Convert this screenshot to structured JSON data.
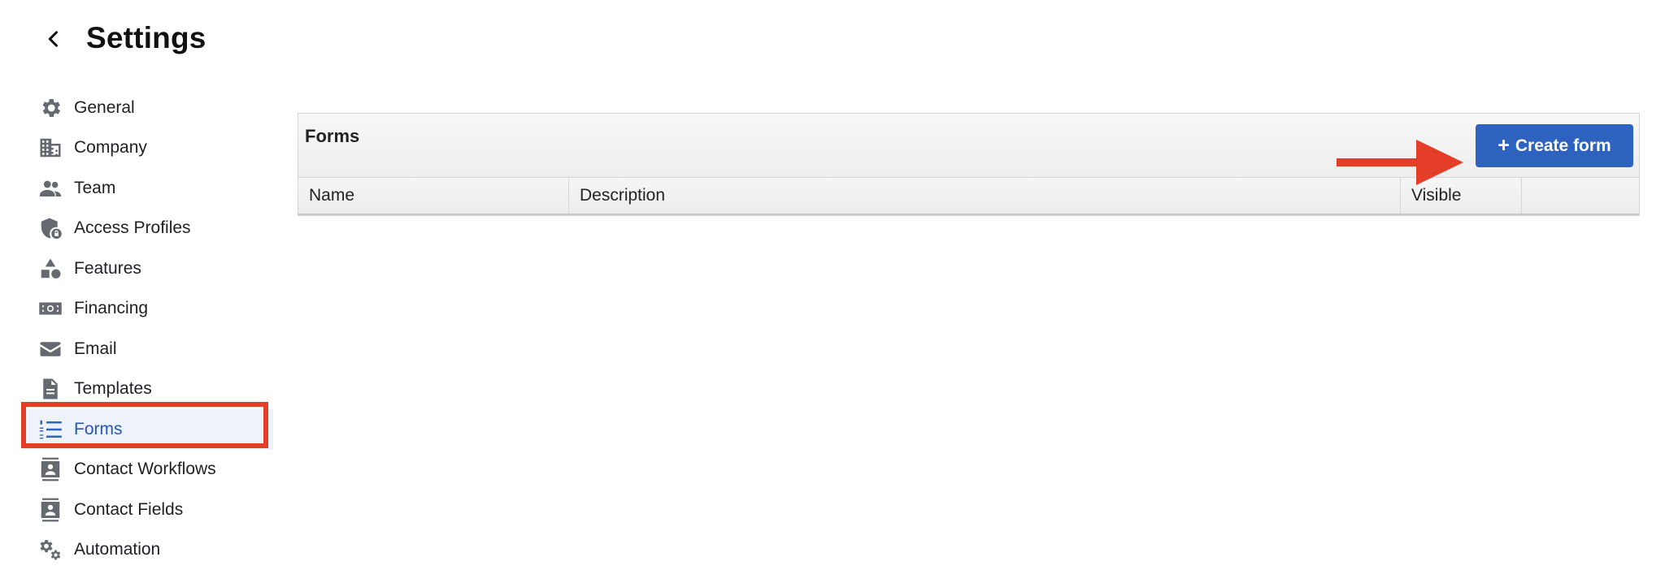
{
  "header": {
    "title": "Settings",
    "back_icon": "chevron-left-icon"
  },
  "sidebar": {
    "items": [
      {
        "label": "General",
        "icon": "gear-icon"
      },
      {
        "label": "Company",
        "icon": "building-icon"
      },
      {
        "label": "Team",
        "icon": "people-icon"
      },
      {
        "label": "Access Profiles",
        "icon": "shield-lock-icon"
      },
      {
        "label": "Features",
        "icon": "shapes-icon"
      },
      {
        "label": "Financing",
        "icon": "money-icon"
      },
      {
        "label": "Email",
        "icon": "envelope-icon"
      },
      {
        "label": "Templates",
        "icon": "document-icon"
      },
      {
        "label": "Forms",
        "icon": "numbered-list-icon",
        "active": true
      },
      {
        "label": "Contact Workflows",
        "icon": "contact-card-icon"
      },
      {
        "label": "Contact Fields",
        "icon": "contact-card-icon"
      },
      {
        "label": "Automation",
        "icon": "gears-icon"
      }
    ]
  },
  "main": {
    "panel_title": "Forms",
    "create_button": {
      "label": "Create form",
      "icon": "plus-icon"
    },
    "columns": [
      "Name",
      "Description",
      "Visible",
      ""
    ]
  },
  "colors": {
    "accent": "#2d63bf",
    "highlight": "#e43d28",
    "active_bg": "#edf2fb",
    "icon_gray": "#666a70"
  }
}
